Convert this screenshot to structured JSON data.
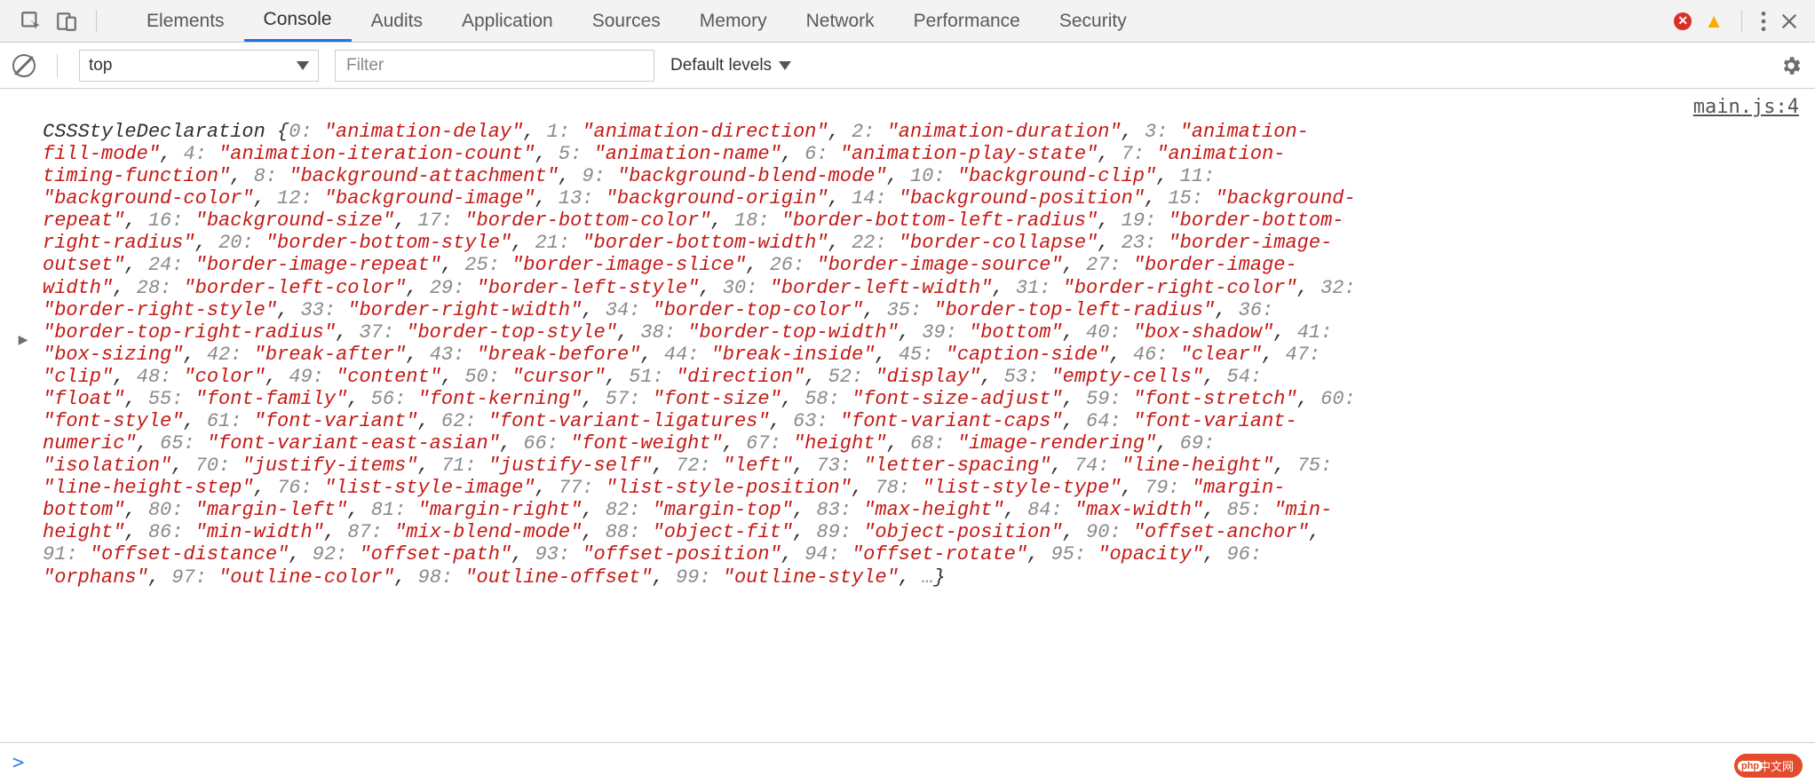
{
  "tabs": [
    "Elements",
    "Console",
    "Audits",
    "Application",
    "Sources",
    "Memory",
    "Network",
    "Performance",
    "Security"
  ],
  "active_tab_index": 1,
  "toolbar": {
    "context": "top",
    "filter_placeholder": "Filter",
    "levels": "Default levels"
  },
  "source_link": "main.js:4",
  "prompt": ">",
  "watermark": "中文网",
  "log": {
    "class_name": "CSSStyleDeclaration",
    "truncation": "…",
    "items": [
      "animation-delay",
      "animation-direction",
      "animation-duration",
      "animation-fill-mode",
      "animation-iteration-count",
      "animation-name",
      "animation-play-state",
      "animation-timing-function",
      "background-attachment",
      "background-blend-mode",
      "background-clip",
      "background-color",
      "background-image",
      "background-origin",
      "background-position",
      "background-repeat",
      "background-size",
      "border-bottom-color",
      "border-bottom-left-radius",
      "border-bottom-right-radius",
      "border-bottom-style",
      "border-bottom-width",
      "border-collapse",
      "border-image-outset",
      "border-image-repeat",
      "border-image-slice",
      "border-image-source",
      "border-image-width",
      "border-left-color",
      "border-left-style",
      "border-left-width",
      "border-right-color",
      "border-right-style",
      "border-right-width",
      "border-top-color",
      "border-top-left-radius",
      "border-top-right-radius",
      "border-top-style",
      "border-top-width",
      "bottom",
      "box-shadow",
      "box-sizing",
      "break-after",
      "break-before",
      "break-inside",
      "caption-side",
      "clear",
      "clip",
      "color",
      "content",
      "cursor",
      "direction",
      "display",
      "empty-cells",
      "float",
      "font-family",
      "font-kerning",
      "font-size",
      "font-size-adjust",
      "font-stretch",
      "font-style",
      "font-variant",
      "font-variant-ligatures",
      "font-variant-caps",
      "font-variant-numeric",
      "font-variant-east-asian",
      "font-weight",
      "height",
      "image-rendering",
      "isolation",
      "justify-items",
      "justify-self",
      "left",
      "letter-spacing",
      "line-height",
      "line-height-step",
      "list-style-image",
      "list-style-position",
      "list-style-type",
      "margin-bottom",
      "margin-left",
      "margin-right",
      "margin-top",
      "max-height",
      "max-width",
      "min-height",
      "min-width",
      "mix-blend-mode",
      "object-fit",
      "object-position",
      "offset-anchor",
      "offset-distance",
      "offset-path",
      "offset-position",
      "offset-rotate",
      "opacity",
      "orphans",
      "outline-color",
      "outline-offset",
      "outline-style"
    ]
  }
}
